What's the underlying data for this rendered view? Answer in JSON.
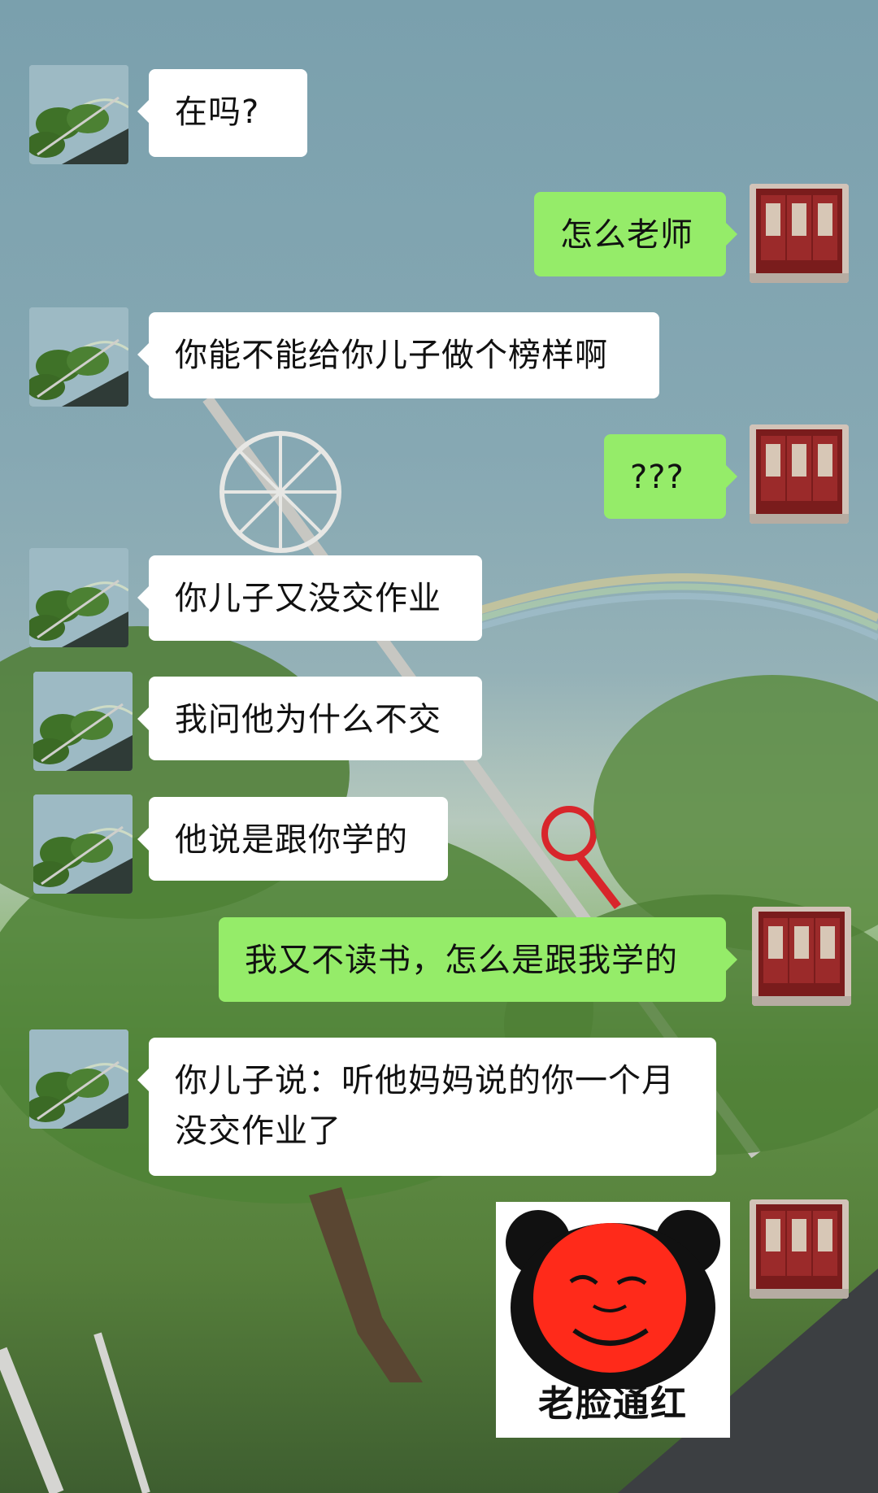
{
  "colors": {
    "incoming_bubble": "#ffffff",
    "outgoing_bubble": "#95ec69",
    "text": "#111111"
  },
  "avatars": {
    "contact": "tree-rainbow-avatar",
    "self": "red-door-avatar"
  },
  "messages": [
    {
      "side": "left",
      "text": "在吗?"
    },
    {
      "side": "right",
      "text": "怎么老师"
    },
    {
      "side": "left",
      "text": "你能不能给你儿子做个榜样啊"
    },
    {
      "side": "right",
      "text": "???"
    },
    {
      "side": "left",
      "text": "你儿子又没交作业"
    },
    {
      "side": "left",
      "text": "我问他为什么不交"
    },
    {
      "side": "left",
      "text": "他说是跟你学的"
    },
    {
      "side": "right",
      "text": "我又不读书，怎么是跟我学的"
    },
    {
      "side": "left",
      "text": "你儿子说：听他妈妈说的你一个月没交作业了"
    }
  ],
  "sticker": {
    "icon": "red-panda-face-meme",
    "caption": "老脸通红"
  }
}
